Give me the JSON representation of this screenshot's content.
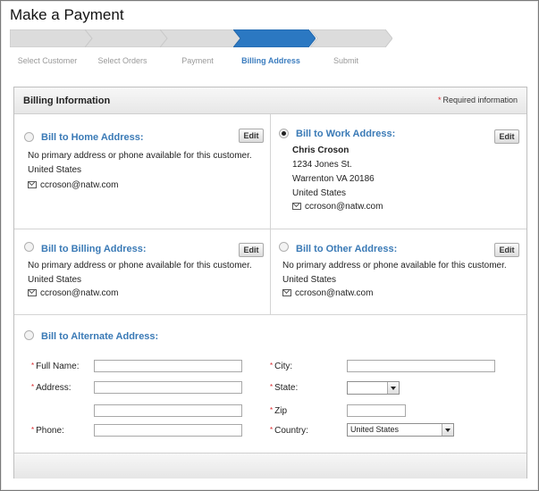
{
  "page": {
    "title": "Make a Payment"
  },
  "steps": [
    {
      "label": "Select Customer",
      "active": false
    },
    {
      "label": "Select Orders",
      "active": false
    },
    {
      "label": "Payment",
      "active": false
    },
    {
      "label": "Billing Address",
      "active": true
    },
    {
      "label": "Submit",
      "active": false
    }
  ],
  "panel": {
    "title": "Billing Information",
    "required_note": "Required information",
    "required_mark": "*"
  },
  "home": {
    "title": "Bill to Home Address:",
    "edit": "Edit",
    "note": "No primary address or phone available for this customer.",
    "country": "United States",
    "email": "ccroson@natw.com",
    "selected": false
  },
  "work": {
    "title": "Bill to Work Address:",
    "edit": "Edit",
    "name": "Chris Croson",
    "street": "1234 Jones St.",
    "city_line": "Warrenton VA 20186",
    "country": "United States",
    "email": "ccroson@natw.com",
    "selected": true
  },
  "billing": {
    "title": "Bill to Billing Address:",
    "edit": "Edit",
    "note": "No primary address or phone available for this customer.",
    "country": "United States",
    "email": "ccroson@natw.com",
    "selected": false
  },
  "other": {
    "title": "Bill to Other Address:",
    "edit": "Edit",
    "note": "No primary address or phone available for this customer.",
    "country": "United States",
    "email": "ccroson@natw.com",
    "selected": false
  },
  "alternate": {
    "title": "Bill to Alternate Address:",
    "selected": false,
    "fields": {
      "full_name": {
        "label": "Full Name:",
        "value": ""
      },
      "address": {
        "label": "Address:",
        "value": ""
      },
      "address2": {
        "value": ""
      },
      "phone": {
        "label": "Phone:",
        "value": ""
      },
      "city": {
        "label": "City:",
        "value": ""
      },
      "state": {
        "label": "State:",
        "value": ""
      },
      "zip": {
        "label": "Zip",
        "value": ""
      },
      "country": {
        "label": "Country:",
        "value": "United States"
      }
    }
  },
  "colors": {
    "accent": "#3a7ab6",
    "step_active": "#2b78c2",
    "required": "#d9262b"
  }
}
